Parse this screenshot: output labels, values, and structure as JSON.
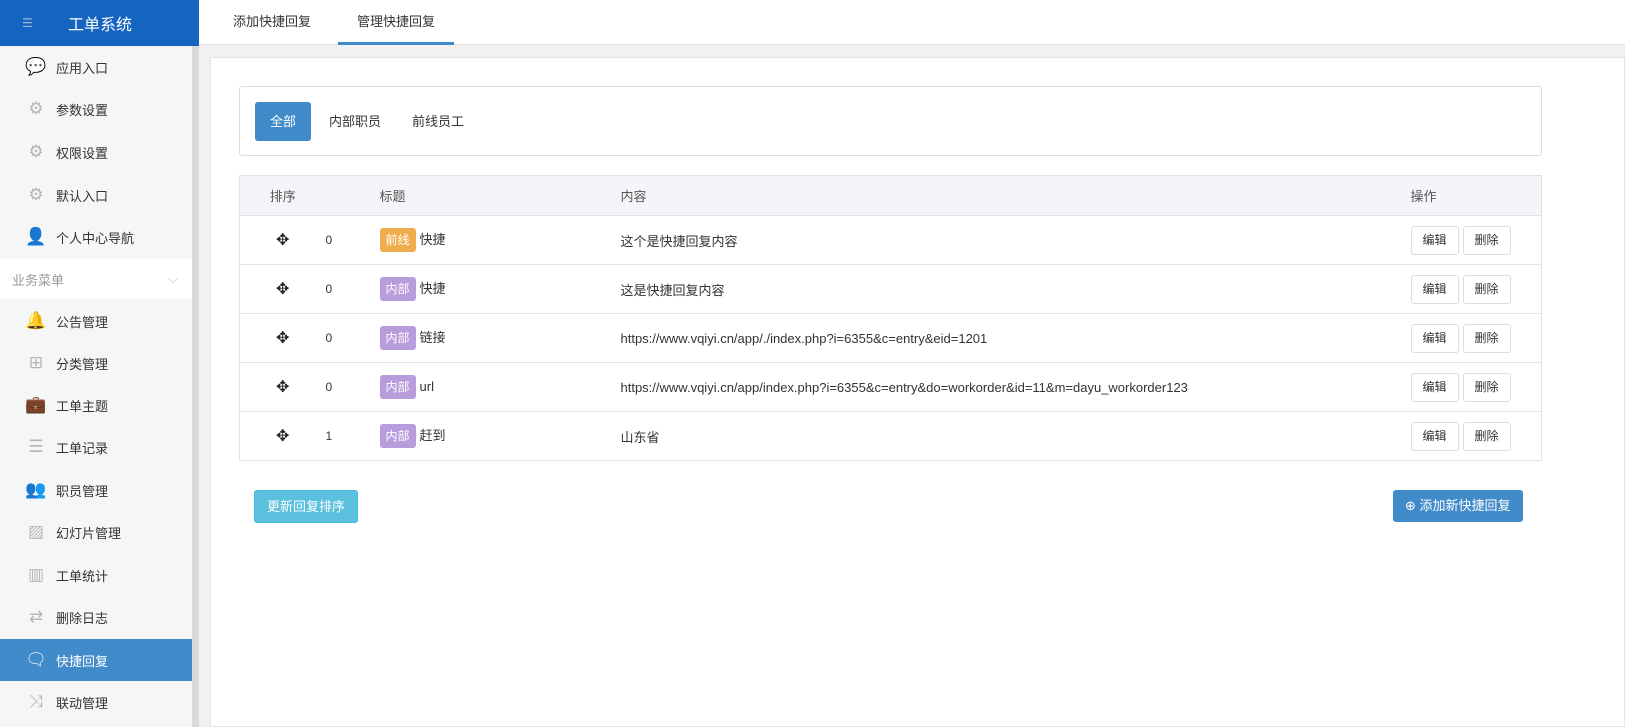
{
  "app": {
    "title": "工单系统"
  },
  "sidebar": {
    "items": [
      {
        "label": "应用入口",
        "icon": "chat-icon"
      },
      {
        "label": "参数设置",
        "icon": "gear-icon"
      },
      {
        "label": "权限设置",
        "icon": "gear-icon"
      },
      {
        "label": "默认入口",
        "icon": "gear-icon"
      },
      {
        "label": "个人中心导航",
        "icon": "user-icon"
      }
    ],
    "group_label": "业务菜单",
    "group_items": [
      {
        "label": "公告管理",
        "icon": "bell-icon"
      },
      {
        "label": "分类管理",
        "icon": "sitemap-icon"
      },
      {
        "label": "工单主题",
        "icon": "briefcase-icon"
      },
      {
        "label": "工单记录",
        "icon": "list-icon"
      },
      {
        "label": "职员管理",
        "icon": "users-icon"
      },
      {
        "label": "幻灯片管理",
        "icon": "image-icon"
      },
      {
        "label": "工单统计",
        "icon": "bar-chart-icon"
      },
      {
        "label": "删除日志",
        "icon": "retweet-icon"
      },
      {
        "label": "快捷回复",
        "icon": "comments-icon"
      },
      {
        "label": "联动管理",
        "icon": "random-icon"
      }
    ]
  },
  "tabs": [
    {
      "label": "添加快捷回复"
    },
    {
      "label": "管理快捷回复"
    }
  ],
  "filter": [
    "全部",
    "内部职员",
    "前线员工"
  ],
  "table": {
    "headers": [
      "排序",
      "",
      "标题",
      "内容",
      "操作"
    ],
    "rows": [
      {
        "order": "0",
        "tag": "前线",
        "tag_color": "#f0ad4e",
        "title": "快捷",
        "content": "这个是快捷回复内容"
      },
      {
        "order": "0",
        "tag": "内部",
        "tag_color": "#b89ddc",
        "title": "快捷",
        "content": "这是快捷回复内容"
      },
      {
        "order": "0",
        "tag": "内部",
        "tag_color": "#b89ddc",
        "title": "链接",
        "content": "https://www.vqiyi.cn/app/./index.php?i=6355&c=entry&eid=1201"
      },
      {
        "order": "0",
        "tag": "内部",
        "tag_color": "#b89ddc",
        "title": "url",
        "content": "https://www.vqiyi.cn/app/index.php?i=6355&c=entry&do=workorder&id=11&m=dayu_workorder123"
      },
      {
        "order": "1",
        "tag": "内部",
        "tag_color": "#b89ddc",
        "title": "赶到",
        "content": "山东省"
      }
    ],
    "edit": "编辑",
    "delete": "删除"
  },
  "buttons": {
    "update_order": "更新回复排序",
    "add_new": "添加新快捷回复"
  }
}
